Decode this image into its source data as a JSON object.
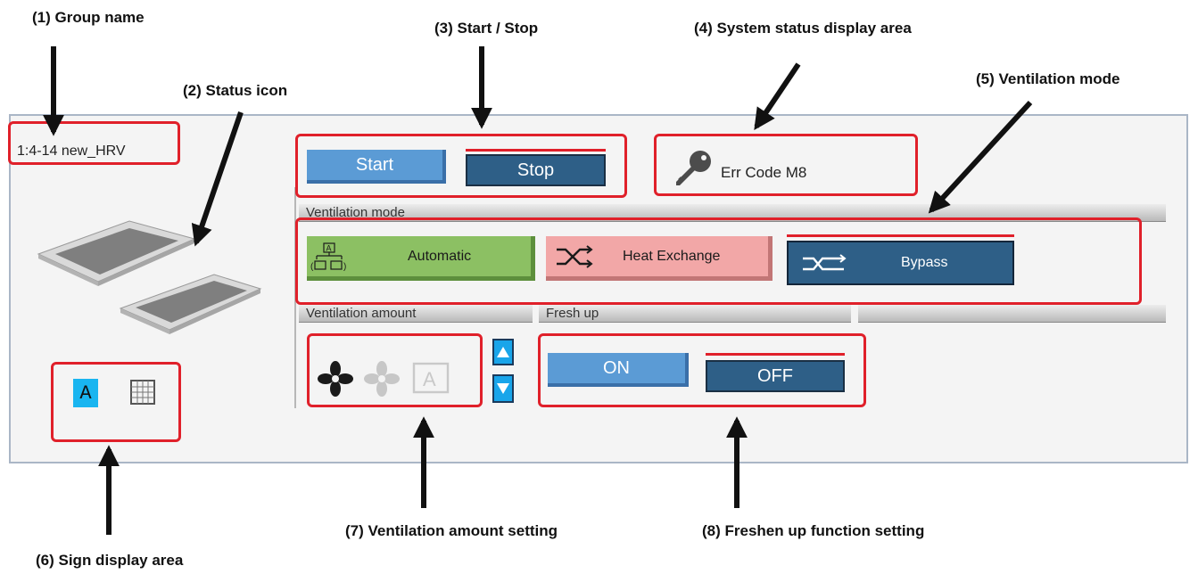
{
  "callouts": {
    "c1": "(1) Group name",
    "c2": "(2) Status icon",
    "c3": "(3) Start / Stop",
    "c4": "(4) System status display area",
    "c5": "(5) Ventilation mode",
    "c6": "(6) Sign display area",
    "c7": "(7) Ventilation amount setting",
    "c8": "(8) Freshen up function setting"
  },
  "group": {
    "name": "1:4-14 new_HRV"
  },
  "startstop": {
    "start": "Start",
    "stop": "Stop"
  },
  "status": {
    "error": "Err Code M8",
    "icon": "key-icon"
  },
  "headers": {
    "ventilation_mode": "Ventilation mode",
    "ventilation_amount": "Ventilation amount",
    "fresh_up": "Fresh up"
  },
  "modes": {
    "automatic": "Automatic",
    "heat_exchange": "Heat Exchange",
    "bypass": "Bypass"
  },
  "freshup": {
    "on": "ON",
    "off": "OFF"
  },
  "sign": {
    "a_label": "A"
  },
  "colors": {
    "accent": "#e0202a",
    "light_blue": "#5b9bd5",
    "dark_blue": "#2e5f87",
    "green": "#8cc063",
    "pink": "#f2a7a7",
    "sign_cyan": "#19b5f0"
  }
}
